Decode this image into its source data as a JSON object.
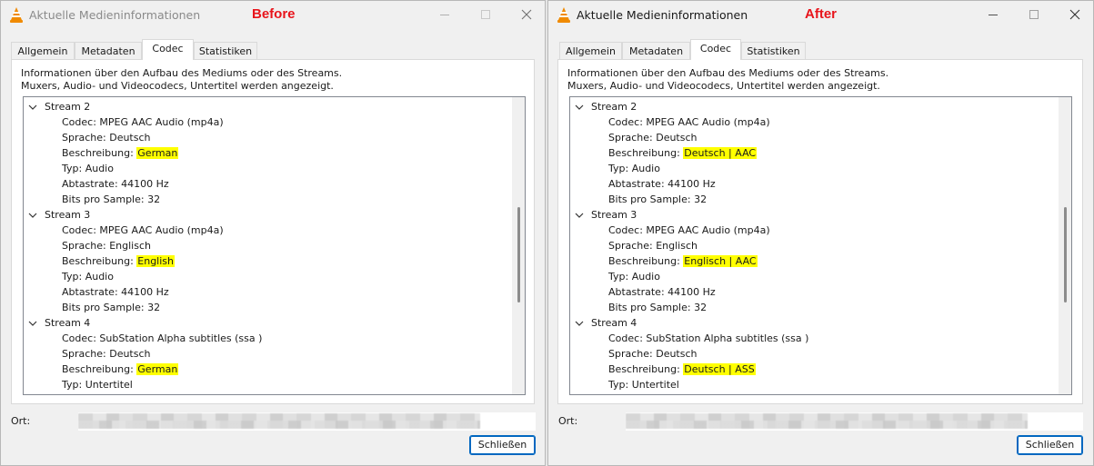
{
  "windows": [
    {
      "title": "Aktuelle Medieninformationen",
      "label": "Before",
      "tabs": [
        "Allgemein",
        "Metadaten",
        "Codec",
        "Statistiken"
      ],
      "active_tab": "Codec",
      "intro_line1": "Informationen über den Aufbau des Mediums oder des Streams.",
      "intro_line2": "Muxers, Audio- und Videocodecs, Untertitel werden angezeigt.",
      "streams": [
        {
          "label": "Stream 2",
          "props": [
            {
              "text": "Codec: MPEG AAC Audio (mp4a)"
            },
            {
              "text": "Sprache: Deutsch"
            },
            {
              "prefix": "Beschreibung: ",
              "highlight": "German"
            },
            {
              "text": "Typ: Audio"
            },
            {
              "text": "Abtastrate: 44100 Hz"
            },
            {
              "text": "Bits pro Sample: 32"
            }
          ]
        },
        {
          "label": "Stream 3",
          "props": [
            {
              "text": "Codec: MPEG AAC Audio (mp4a)"
            },
            {
              "text": "Sprache: Englisch"
            },
            {
              "prefix": "Beschreibung: ",
              "highlight": "English"
            },
            {
              "text": "Typ: Audio"
            },
            {
              "text": "Abtastrate: 44100 Hz"
            },
            {
              "text": "Bits pro Sample: 32"
            }
          ]
        },
        {
          "label": "Stream 4",
          "props": [
            {
              "text": "Codec: SubStation Alpha subtitles (ssa )"
            },
            {
              "text": "Sprache: Deutsch"
            },
            {
              "prefix": "Beschreibung: ",
              "highlight": "German"
            },
            {
              "text": "Typ: Untertitel"
            }
          ]
        }
      ],
      "location_label": "Ort:",
      "close_button": "Schließen"
    },
    {
      "title": "Aktuelle Medieninformationen",
      "label": "After",
      "tabs": [
        "Allgemein",
        "Metadaten",
        "Codec",
        "Statistiken"
      ],
      "active_tab": "Codec",
      "intro_line1": "Informationen über den Aufbau des Mediums oder des Streams.",
      "intro_line2": "Muxers, Audio- und Videocodecs, Untertitel werden angezeigt.",
      "streams": [
        {
          "label": "Stream 2",
          "props": [
            {
              "text": "Codec: MPEG AAC Audio (mp4a)"
            },
            {
              "text": "Sprache: Deutsch"
            },
            {
              "prefix": "Beschreibung: ",
              "highlight": "Deutsch | AAC"
            },
            {
              "text": "Typ: Audio"
            },
            {
              "text": "Abtastrate: 44100 Hz"
            },
            {
              "text": "Bits pro Sample: 32"
            }
          ]
        },
        {
          "label": "Stream 3",
          "props": [
            {
              "text": "Codec: MPEG AAC Audio (mp4a)"
            },
            {
              "text": "Sprache: Englisch"
            },
            {
              "prefix": "Beschreibung: ",
              "highlight": "Englisch | AAC"
            },
            {
              "text": "Typ: Audio"
            },
            {
              "text": "Abtastrate: 44100 Hz"
            },
            {
              "text": "Bits pro Sample: 32"
            }
          ]
        },
        {
          "label": "Stream 4",
          "props": [
            {
              "text": "Codec: SubStation Alpha subtitles (ssa )"
            },
            {
              "text": "Sprache: Deutsch"
            },
            {
              "prefix": "Beschreibung: ",
              "highlight": "Deutsch | ASS"
            },
            {
              "text": "Typ: Untertitel"
            }
          ]
        }
      ],
      "location_label": "Ort:",
      "close_button": "Schließen"
    }
  ],
  "colors": {
    "highlight": "#ffff00",
    "label_red": "#e8141b",
    "button_border": "#0067c0"
  },
  "icons": [
    "vlc-cone-icon",
    "minimize-icon",
    "maximize-icon",
    "close-icon",
    "chevron-down-icon"
  ]
}
